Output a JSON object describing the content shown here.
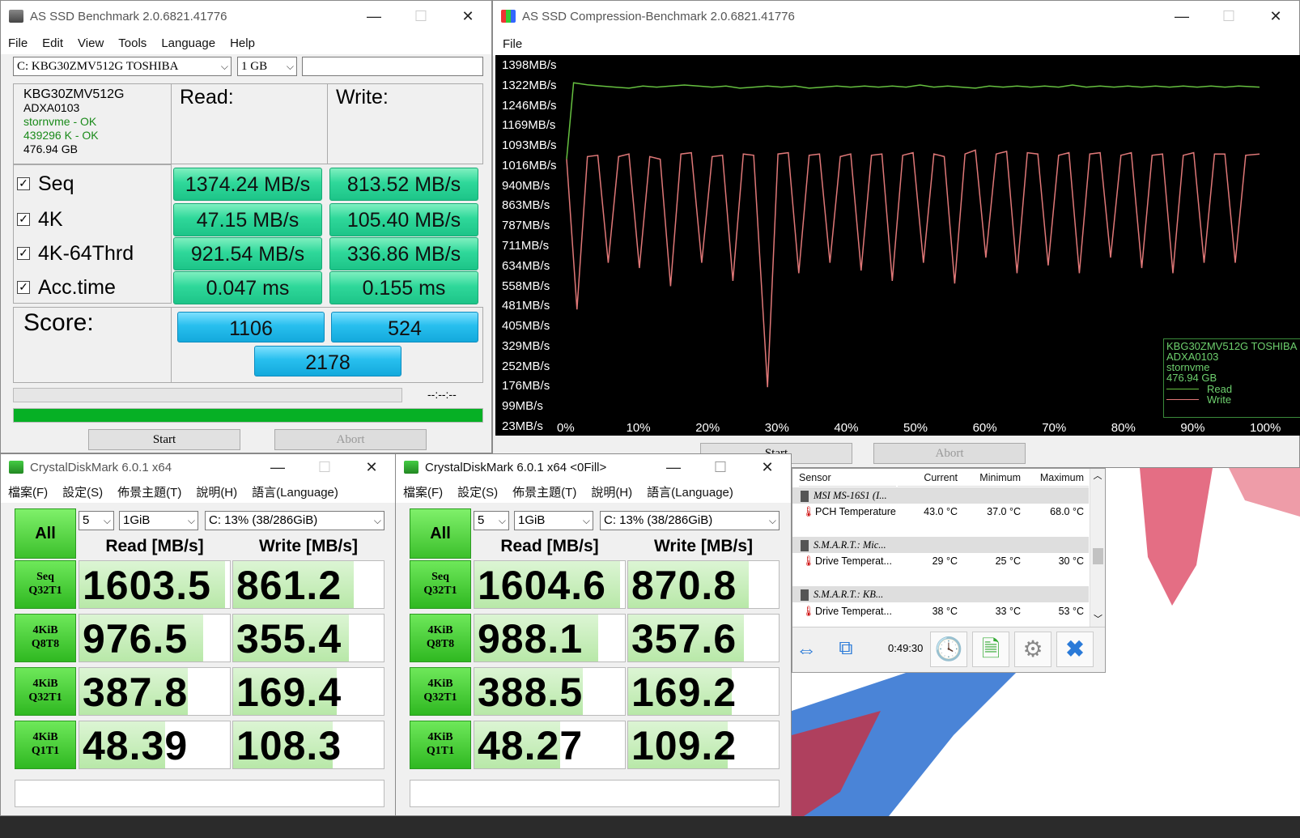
{
  "as_ssd": {
    "title": "AS SSD Benchmark 2.0.6821.41776",
    "menu": [
      "File",
      "Edit",
      "View",
      "Tools",
      "Language",
      "Help"
    ],
    "drive": "C: KBG30ZMV512G TOSHIBA",
    "size": "1 GB",
    "info": [
      "KBG30ZMV512G",
      "ADXA0103",
      "stornvme - OK",
      "439296 K - OK",
      "476.94 GB"
    ],
    "read_header": "Read:",
    "write_header": "Write:",
    "rows": [
      {
        "label": "Seq",
        "read": "1374.24 MB/s",
        "write": "813.52 MB/s"
      },
      {
        "label": "4K",
        "read": "47.15 MB/s",
        "write": "105.40 MB/s"
      },
      {
        "label": "4K-64Thrd",
        "read": "921.54 MB/s",
        "write": "336.86 MB/s"
      },
      {
        "label": "Acc.time",
        "read": "0.047 ms",
        "write": "0.155 ms"
      }
    ],
    "score_label": "Score:",
    "score_read": "1106",
    "score_write": "524",
    "score_total": "2178",
    "elapsed": "--:--:--",
    "start": "Start",
    "abort": "Abort"
  },
  "compression": {
    "title": "AS SSD Compression-Benchmark 2.0.6821.41776",
    "menu": [
      "File"
    ],
    "start": "Start",
    "abort": "Abort",
    "legend": [
      "KBG30ZMV512G TOSHIBA",
      "ADXA0103",
      "stornvme",
      "476.94 GB"
    ],
    "legend_read": "Read",
    "legend_write": "Write",
    "colors": {
      "read": "#66c040",
      "write": "#e07878"
    }
  },
  "chart_data": {
    "type": "line",
    "title": "",
    "xlabel": "",
    "ylabel": "",
    "y_ticks": [
      "1398MB/s",
      "1322MB/s",
      "1246MB/s",
      "1169MB/s",
      "1093MB/s",
      "1016MB/s",
      "940MB/s",
      "863MB/s",
      "787MB/s",
      "711MB/s",
      "634MB/s",
      "558MB/s",
      "481MB/s",
      "405MB/s",
      "329MB/s",
      "252MB/s",
      "176MB/s",
      "99MB/s",
      "23MB/s"
    ],
    "x_ticks": [
      "0%",
      "10%",
      "20%",
      "30%",
      "40%",
      "50%",
      "60%",
      "70%",
      "80%",
      "90%",
      "100%"
    ],
    "ylim": [
      23,
      1398
    ],
    "xlim": [
      0,
      100
    ],
    "grid": false,
    "legend_position": "bottom-right",
    "series": [
      {
        "name": "Read",
        "values": [
          [
            0,
            1040
          ],
          [
            1,
            1335
          ],
          [
            3,
            1327
          ],
          [
            5,
            1322
          ],
          [
            7,
            1318
          ],
          [
            9,
            1314
          ],
          [
            11,
            1322
          ],
          [
            13,
            1318
          ],
          [
            15,
            1322
          ],
          [
            17,
            1326
          ],
          [
            19,
            1322
          ],
          [
            21,
            1318
          ],
          [
            23,
            1322
          ],
          [
            25,
            1314
          ],
          [
            27,
            1318
          ],
          [
            29,
            1322
          ],
          [
            31,
            1318
          ],
          [
            33,
            1322
          ],
          [
            35,
            1314
          ],
          [
            37,
            1318
          ],
          [
            39,
            1322
          ],
          [
            41,
            1318
          ],
          [
            43,
            1322
          ],
          [
            45,
            1318
          ],
          [
            47,
            1322
          ],
          [
            49,
            1318
          ],
          [
            51,
            1326
          ],
          [
            53,
            1318
          ],
          [
            55,
            1322
          ],
          [
            57,
            1318
          ],
          [
            59,
            1314
          ],
          [
            61,
            1322
          ],
          [
            63,
            1318
          ],
          [
            65,
            1322
          ],
          [
            67,
            1318
          ],
          [
            69,
            1322
          ],
          [
            71,
            1318
          ],
          [
            73,
            1326
          ],
          [
            75,
            1318
          ],
          [
            77,
            1322
          ],
          [
            79,
            1318
          ],
          [
            81,
            1322
          ],
          [
            83,
            1318
          ],
          [
            85,
            1322
          ],
          [
            87,
            1318
          ],
          [
            89,
            1322
          ],
          [
            91,
            1318
          ],
          [
            93,
            1322
          ],
          [
            95,
            1318
          ],
          [
            97,
            1322
          ],
          [
            100,
            1318
          ]
        ]
      },
      {
        "name": "Write",
        "values": [
          [
            0,
            1040
          ],
          [
            1.5,
            460
          ],
          [
            3,
            1050
          ],
          [
            4.5,
            1055
          ],
          [
            6,
            640
          ],
          [
            7.5,
            1050
          ],
          [
            9,
            1060
          ],
          [
            10.5,
            620
          ],
          [
            12,
            1050
          ],
          [
            13.5,
            1040
          ],
          [
            15,
            550
          ],
          [
            16.5,
            1060
          ],
          [
            18,
            1065
          ],
          [
            19.5,
            640
          ],
          [
            21,
            1050
          ],
          [
            22.5,
            1055
          ],
          [
            24,
            570
          ],
          [
            25.5,
            1060
          ],
          [
            27,
            1055
          ],
          [
            29,
            160
          ],
          [
            30.5,
            1060
          ],
          [
            32,
            1065
          ],
          [
            33.5,
            600
          ],
          [
            35,
            1055
          ],
          [
            36.5,
            1060
          ],
          [
            38,
            640
          ],
          [
            39.5,
            1050
          ],
          [
            41,
            1060
          ],
          [
            42.5,
            610
          ],
          [
            44,
            1055
          ],
          [
            45.5,
            1060
          ],
          [
            47,
            570
          ],
          [
            48.5,
            1055
          ],
          [
            50,
            1065
          ],
          [
            51.5,
            640
          ],
          [
            53,
            1060
          ],
          [
            54.5,
            1050
          ],
          [
            56,
            560
          ],
          [
            57.5,
            1060
          ],
          [
            59,
            1075
          ],
          [
            60.5,
            660
          ],
          [
            62,
            1060
          ],
          [
            63.5,
            1070
          ],
          [
            65,
            600
          ],
          [
            66.5,
            1065
          ],
          [
            68,
            1060
          ],
          [
            69.5,
            630
          ],
          [
            71,
            1055
          ],
          [
            72.5,
            1065
          ],
          [
            74,
            600
          ],
          [
            75.5,
            1060
          ],
          [
            77,
            1065
          ],
          [
            78.5,
            660
          ],
          [
            80,
            1055
          ],
          [
            81.5,
            1065
          ],
          [
            83,
            620
          ],
          [
            84.5,
            1055
          ],
          [
            86,
            1060
          ],
          [
            87.5,
            600
          ],
          [
            89,
            1055
          ],
          [
            90.5,
            1065
          ],
          [
            92,
            640
          ],
          [
            93.5,
            1060
          ],
          [
            95,
            1060
          ],
          [
            96.5,
            640
          ],
          [
            98,
            1055
          ],
          [
            100,
            1060
          ]
        ]
      }
    ]
  },
  "cdm_left": {
    "title": "CrystalDiskMark 6.0.1 x64",
    "menu": [
      "檔案(F)",
      "設定(S)",
      "佈景主題(T)",
      "說明(H)",
      "語言(Language)"
    ],
    "all": "All",
    "count": "5",
    "size": "1GiB",
    "drive": "C: 13% (38/286GiB)",
    "read_header": "Read [MB/s]",
    "write_header": "Write [MB/s]",
    "rows": [
      {
        "label1": "Seq",
        "label2": "Q32T1",
        "read": "1603.5",
        "write": "861.2",
        "read_fill": 0.97,
        "write_fill": 0.8
      },
      {
        "label1": "4KiB",
        "label2": "Q8T8",
        "read": "976.5",
        "write": "355.4",
        "read_fill": 0.82,
        "write_fill": 0.77
      },
      {
        "label1": "4KiB",
        "label2": "Q32T1",
        "read": "387.8",
        "write": "169.4",
        "read_fill": 0.72,
        "write_fill": 0.69
      },
      {
        "label1": "4KiB",
        "label2": "Q1T1",
        "read": "48.39",
        "write": "108.3",
        "read_fill": 0.57,
        "write_fill": 0.66
      }
    ]
  },
  "cdm_right": {
    "title": "CrystalDiskMark 6.0.1 x64 <0Fill>",
    "menu": [
      "檔案(F)",
      "設定(S)",
      "佈景主題(T)",
      "說明(H)",
      "語言(Language)"
    ],
    "all": "All",
    "count": "5",
    "size": "1GiB",
    "drive": "C: 13% (38/286GiB)",
    "read_header": "Read [MB/s]",
    "write_header": "Write [MB/s]",
    "rows": [
      {
        "label1": "Seq",
        "label2": "Q32T1",
        "read": "1604.6",
        "write": "870.8",
        "read_fill": 0.97,
        "write_fill": 0.8
      },
      {
        "label1": "4KiB",
        "label2": "Q8T8",
        "read": "988.1",
        "write": "357.6",
        "read_fill": 0.82,
        "write_fill": 0.77
      },
      {
        "label1": "4KiB",
        "label2": "Q32T1",
        "read": "388.5",
        "write": "169.2",
        "read_fill": 0.72,
        "write_fill": 0.69
      },
      {
        "label1": "4KiB",
        "label2": "Q1T1",
        "read": "48.27",
        "write": "109.2",
        "read_fill": 0.57,
        "write_fill": 0.66
      }
    ]
  },
  "hwinfo": {
    "headers": [
      "Sensor",
      "Current",
      "Minimum",
      "Maximum"
    ],
    "groups": [
      {
        "name": "MSI MS-16S1 (I...",
        "sensor": "PCH Temperature",
        "current": "43.0 °C",
        "min": "37.0 °C",
        "max": "68.0 °C"
      },
      {
        "name": "S.M.A.R.T.: Mic...",
        "sensor": "Drive Temperat...",
        "current": "29 °C",
        "min": "25 °C",
        "max": "30 °C"
      },
      {
        "name": "S.M.A.R.T.: KB...",
        "sensor": "Drive Temperat...",
        "current": "38 °C",
        "min": "33 °C",
        "max": "53 °C"
      }
    ],
    "timer": "0:49:30"
  }
}
